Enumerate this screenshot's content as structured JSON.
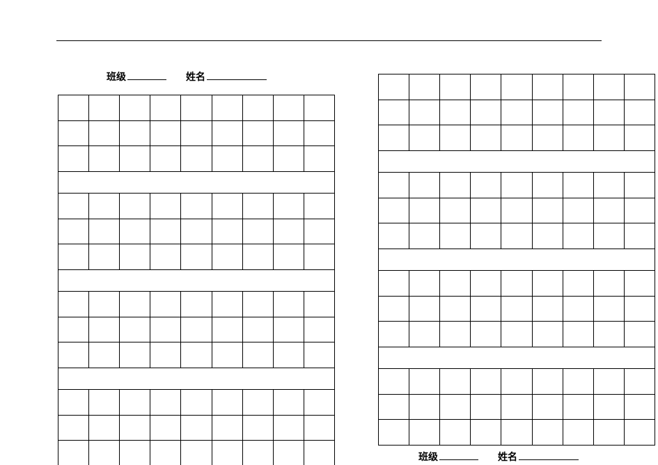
{
  "labels": {
    "class": "班级",
    "name": "姓名"
  },
  "grid": {
    "columns": 9,
    "blocks_per_panel": 4,
    "rows_per_block": 3
  }
}
